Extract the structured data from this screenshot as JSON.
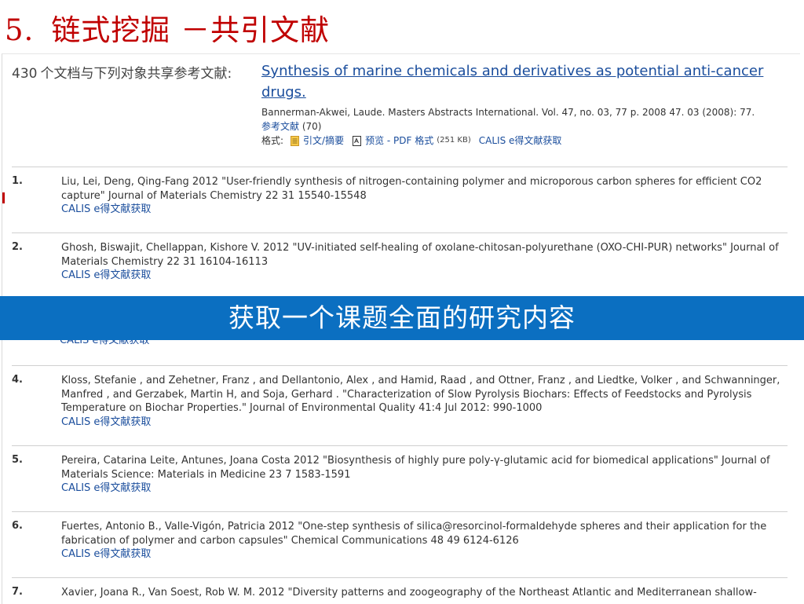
{
  "slide": {
    "number": "5.",
    "title": "链式挖掘 －共引文献"
  },
  "header": {
    "count": "430",
    "count_label": "个文档与下列对象共享参考文献:",
    "target_title": "Synthesis of marine chemicals and derivatives as potential anti-cancer drugs.",
    "meta": "Bannerman-Akwei, Laude. Masters Abstracts International. Vol. 47, no. 03, 77 p. 2008 47. 03  (2008): 77.",
    "refs_label": "参考文献",
    "refs_count": "(70)",
    "formats_label": "格式:",
    "citation_label": "引文/摘要",
    "preview_label": "预览 - PDF 格式",
    "pdf_size": "(251 KB)",
    "calis_label": "CALIS e得文献获取"
  },
  "records": [
    {
      "index": "1.",
      "text": "Liu, Lei, Deng, Qing-Fang 2012 \"User-friendly synthesis of nitrogen-containing polymer and microporous carbon spheres for efficient CO2 capture\" Journal of Materials Chemistry 22 31 15540-15548",
      "calis": "CALIS e得文献获取"
    },
    {
      "index": "2.",
      "text": "Ghosh, Biswajit, Chellappan, Kishore V. 2012 \"UV-initiated self-healing of oxolane-chitosan-polyurethane (OXO-CHI-PUR) networks\" Journal of Materials Chemistry 22 31 16104-16113",
      "calis": "CALIS e得文献获取"
    },
    {
      "index": "4.",
      "text": "Kloss, Stefanie , and Zehetner, Franz , and Dellantonio, Alex , and Hamid, Raad , and Ottner, Franz , and Liedtke, Volker , and Schwanninger, Manfred , and Gerzabek, Martin H, and Soja, Gerhard . \"Characterization of Slow Pyrolysis Biochars: Effects of Feedstocks and Pyrolysis Temperature on Biochar Properties.\" Journal of Environmental Quality 41:4 Jul 2012: 990-1000",
      "calis": "CALIS e得文献获取"
    },
    {
      "index": "5.",
      "text": "Pereira, Catarina Leite, Antunes, Joana Costa 2012 \"Biosynthesis of highly pure poly-γ-glutamic acid for biomedical applications\" Journal of Materials Science: Materials in Medicine 23 7 1583-1591",
      "calis": "CALIS e得文献获取"
    },
    {
      "index": "6.",
      "text": "Fuertes, Antonio B., Valle-Vigón, Patricia 2012 \"One-step synthesis of silica@resorcinol-formaldehyde spheres and their application for the fabrication of polymer and carbon capsules\" Chemical Communications 48 49 6124-6126",
      "calis": "CALIS e得文献获取"
    },
    {
      "index": "7.",
      "text": "Xavier, Joana R., Van Soest, Rob W. M. 2012 \"Diversity patterns and zoogeography of the Northeast Atlantic and Mediterranean shallow-",
      "calis": ""
    }
  ],
  "peek_calis": "CALIS e得文献获取",
  "banner": "获取一个课题全面的研究内容",
  "colors": {
    "title_red": "#c00000",
    "link_blue": "#1a4d9c",
    "banner_blue": "#0b6fc1"
  },
  "icons": [
    "doc-icon",
    "pdf-icon"
  ]
}
